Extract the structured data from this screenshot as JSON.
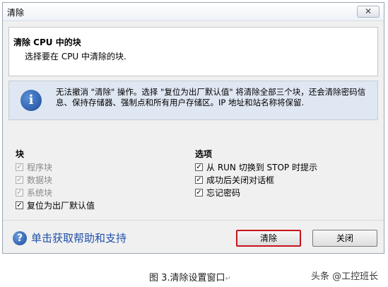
{
  "window": {
    "title": "清除",
    "close_label": "✕"
  },
  "header": {
    "title": "清除 CPU 中的块",
    "subtitle": "选择要在 CPU 中清除的块."
  },
  "info": {
    "icon": "info-icon",
    "text": "无法撤消 \"清除\" 操作。选择 \"复位为出厂默认值\" 将清除全部三个块，还会清除密码信息、保持存储器、强制点和所有用户存储区。IP 地址和站名称将保留."
  },
  "blocks": {
    "label": "块",
    "items": [
      {
        "label": "程序块",
        "checked": true,
        "enabled": false
      },
      {
        "label": "数据块",
        "checked": true,
        "enabled": false
      },
      {
        "label": "系统块",
        "checked": true,
        "enabled": false
      },
      {
        "label": "复位为出厂默认值",
        "checked": true,
        "enabled": true
      }
    ]
  },
  "options": {
    "label": "选项",
    "items": [
      {
        "label": "从 RUN 切换到 STOP 时提示",
        "checked": true
      },
      {
        "label": "成功后关闭对话框",
        "checked": true
      },
      {
        "label": "忘记密码",
        "checked": true
      }
    ]
  },
  "footer": {
    "help_icon": "help-icon",
    "help_text": "单击获取帮助和支持",
    "clear_button": "清除",
    "close_button": "关闭"
  },
  "caption": {
    "text": "图 3.清除设置窗口",
    "mark": "↵"
  },
  "watermark": {
    "text": "头条 @工控班长"
  }
}
